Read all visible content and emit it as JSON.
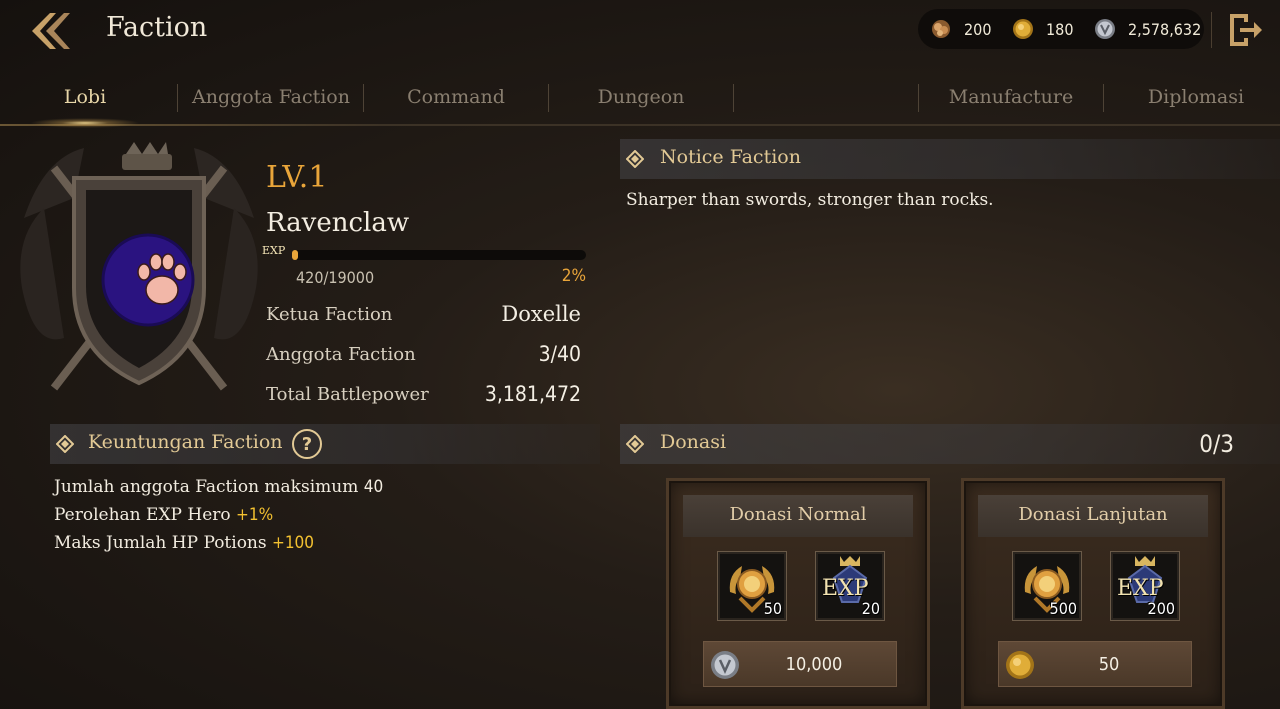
{
  "header": {
    "title": "Faction",
    "currencies": [
      {
        "icon": "ore-icon",
        "value": "200",
        "color": "#c9955a"
      },
      {
        "icon": "gold-coin-icon",
        "value": "180",
        "color": "#d9a531"
      },
      {
        "icon": "silver-coin-icon",
        "value": "2,578,632",
        "color": "#b8bcc4"
      }
    ]
  },
  "tabs": [
    {
      "label": "Lobi",
      "active": true
    },
    {
      "label": "Anggota Faction",
      "active": false
    },
    {
      "label": "Command",
      "active": false
    },
    {
      "label": "Dungeon",
      "active": false
    },
    {
      "label": "Manufacture",
      "active": false
    },
    {
      "label": "Diplomasi",
      "active": false
    }
  ],
  "faction": {
    "level": "LV.1",
    "name": "Ravenclaw",
    "emblem_icon": "paw-icon",
    "exp_badge": "EXP",
    "exp_text": "420/19000",
    "exp_percent": "2%",
    "exp_fraction": 0.022,
    "leader_label": "Ketua Faction",
    "leader_value": "Doxelle",
    "members_label": "Anggota Faction",
    "members_value": "3/40",
    "bp_label": "Total Battlepower",
    "bp_value": "3,181,472"
  },
  "notice": {
    "title": "Notice Faction",
    "text": "Sharper than swords, stronger than rocks."
  },
  "benefits": {
    "title": "Keuntungan Faction",
    "help": "?",
    "items": [
      {
        "label": "Jumlah anggota Faction maksimum ",
        "value": "40",
        "highlight": false
      },
      {
        "label": "Perolehan EXP Hero ",
        "value": "+1%",
        "highlight": true
      },
      {
        "label": "Maks Jumlah HP Potions ",
        "value": "+100",
        "highlight": true
      }
    ]
  },
  "donation": {
    "title": "Donasi",
    "count": "0/3",
    "cards": [
      {
        "title": "Donasi Normal",
        "rewards": [
          {
            "icon": "faction-medal-icon",
            "qty": "50"
          },
          {
            "icon": "exp-icon",
            "label": "EXP",
            "qty": "20"
          }
        ],
        "cost_icon": "silver-coin-icon",
        "cost": "10,000"
      },
      {
        "title": "Donasi Lanjutan",
        "rewards": [
          {
            "icon": "faction-medal-icon",
            "qty": "500"
          },
          {
            "icon": "exp-icon",
            "label": "EXP",
            "qty": "200"
          }
        ],
        "cost_icon": "gold-coin-icon",
        "cost": "50"
      }
    ]
  },
  "colors": {
    "accent_gold": "#e9a53a",
    "highlight_yellow": "#f2c030",
    "section_title": "#e2c995"
  }
}
